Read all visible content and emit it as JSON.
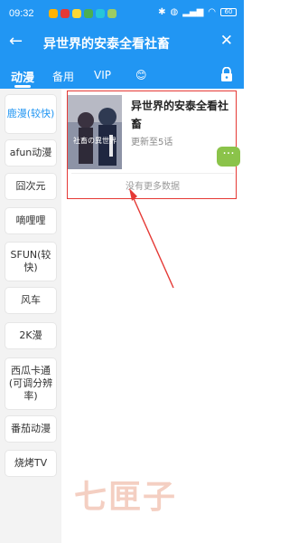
{
  "status_bar": {
    "time": "09:32",
    "battery": "60"
  },
  "app_bar": {
    "title": "异世界的安泰全看社畜"
  },
  "tabs": [
    {
      "label": "动漫",
      "active": true
    },
    {
      "label": "备用",
      "active": false
    },
    {
      "label": "VIP",
      "active": false
    },
    {
      "label": "😊",
      "active": false
    }
  ],
  "sidebar": {
    "items": [
      {
        "label": "鹿漫(较快)",
        "active": true
      },
      {
        "label": "afun动漫",
        "active": false
      },
      {
        "label": "囧次元",
        "active": false
      },
      {
        "label": "嘀哩哩",
        "active": false
      },
      {
        "label": "SFUN(较快)",
        "active": false
      },
      {
        "label": "风车",
        "active": false
      },
      {
        "label": "2K漫",
        "active": false
      },
      {
        "label": "西瓜卡通(可调分辨率)",
        "active": false
      },
      {
        "label": "番茄动漫",
        "active": false
      },
      {
        "label": "烧烤TV",
        "active": false
      }
    ]
  },
  "result": {
    "title": "异世界的安泰全看社畜",
    "subtitle": "更新至5话",
    "cover_text": "社畜の異世界"
  },
  "no_more_text": "没有更多数据",
  "more_button": "···",
  "watermark": "七匣子",
  "colors": {
    "primary": "#2196f3",
    "highlight": "#e53935",
    "fab": "#8bc34a"
  }
}
